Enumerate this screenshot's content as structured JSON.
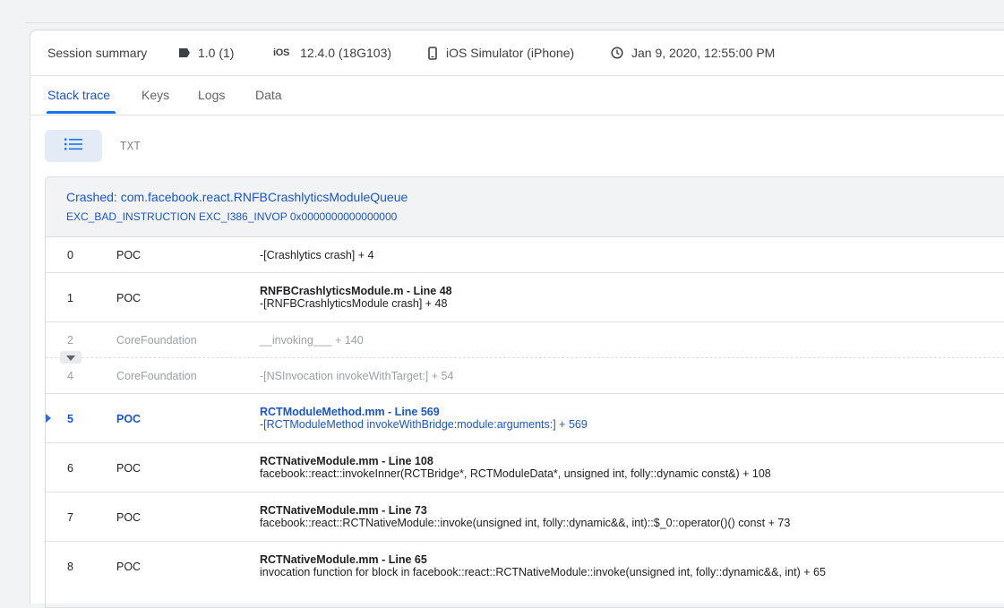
{
  "summary": {
    "title": "Session summary",
    "version": "1.0 (1)",
    "os_badge": "iOS",
    "os_version": "12.4.0 (18G103)",
    "device": "iOS Simulator (iPhone)",
    "timestamp": "Jan 9, 2020, 12:55:00 PM",
    "icons": [
      "tag-icon",
      "ios-icon",
      "phone-icon",
      "clock-icon"
    ]
  },
  "tabs": [
    {
      "label": "Stack trace",
      "active": true
    },
    {
      "label": "Keys",
      "active": false
    },
    {
      "label": "Logs",
      "active": false
    },
    {
      "label": "Data",
      "active": false
    }
  ],
  "view": {
    "list_icon": "list-icon",
    "txt_label": "TXT"
  },
  "trace": {
    "crashed_title": "Crashed: com.facebook.react.RNFBCrashlyticsModuleQueue",
    "exception": "EXC_BAD_INSTRUCTION EXC_I386_INVOP 0x0000000000000000",
    "expand_icon": "triangle-down-icon",
    "frames": [
      {
        "index": "0",
        "library": "POC",
        "file": "",
        "symbol": "-[Crashlytics crash] + 4",
        "dim": false,
        "highlight": false
      },
      {
        "index": "1",
        "library": "POC",
        "file": "RNFBCrashlyticsModule.m - Line 48",
        "symbol": "-[RNFBCrashlyticsModule crash] + 48",
        "dim": false,
        "highlight": false
      },
      {
        "index": "2",
        "library": "CoreFoundation",
        "file": "",
        "symbol": "__invoking___ + 140",
        "dim": true,
        "highlight": false
      },
      {
        "index": "4",
        "library": "CoreFoundation",
        "file": "",
        "symbol": "-[NSInvocation invokeWithTarget:] + 54",
        "dim": true,
        "highlight": false
      },
      {
        "index": "5",
        "library": "POC",
        "file": "RCTModuleMethod.mm - Line 569",
        "symbol": "-[RCTModuleMethod invokeWithBridge:module:arguments:] + 569",
        "dim": false,
        "highlight": true
      },
      {
        "index": "6",
        "library": "POC",
        "file": "RCTNativeModule.mm - Line 108",
        "symbol": "facebook::react::invokeInner(RCTBridge*, RCTModuleData*, unsigned int, folly::dynamic const&) + 108",
        "dim": false,
        "highlight": false
      },
      {
        "index": "7",
        "library": "POC",
        "file": "RCTNativeModule.mm - Line 73",
        "symbol": "facebook::react::RCTNativeModule::invoke(unsigned int, folly::dynamic&&, int)::$_0::operator()() const + 73",
        "dim": false,
        "highlight": false
      },
      {
        "index": "8",
        "library": "POC",
        "file": "RCTNativeModule.mm - Line 65",
        "symbol": "invocation function for block in facebook::react::RCTNativeModule::invoke(unsigned int, folly::dynamic&&, int) + 65",
        "dim": false,
        "highlight": false
      }
    ]
  },
  "colors": {
    "accent": "#1a73e8",
    "accent_text": "#1a56c9",
    "dim_text": "#9aa0a6"
  }
}
